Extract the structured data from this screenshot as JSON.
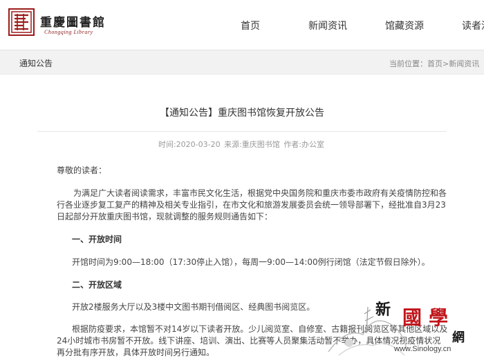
{
  "header": {
    "logo_cn": "重慶圖書館",
    "logo_en": "Chongqing Library",
    "nav": [
      "首页",
      "新闻资讯",
      "馆藏资源",
      "读者活"
    ]
  },
  "crumbbar": {
    "section_title": "通知公告",
    "location_label": "当前位置：",
    "crumbs": [
      "首页",
      ">",
      "新闻资讯"
    ]
  },
  "article": {
    "title": "【通知公告】重庆图书馆恢复开放公告",
    "time_label": "时间:2020-03-20",
    "source_label": "来源:重庆图书馆",
    "author_label": "作者:办公室",
    "greeting": "尊敬的读者：",
    "intro": "为满足广大读者阅读需求，丰富市民文化生活，根据党中央国务院和重庆市委市政府有关疫情防控和各行各业逐步复工复产的精神及相关专业指引，在市文化和旅游发展委员会统一领导部署下，经批准自3月23日起部分开放重庆图书馆，现就调整的服务规则通告如下：",
    "section1_heading": "一、开放时间",
    "section1_text": "开馆时间为9:00—18:00（17:30停止入馆），每周一9:00—14:00例行闭馆（法定节假日除外）。",
    "section2_heading": "二、开放区域",
    "section2_text": "开放2楼服务大厅以及3楼中文图书期刊借阅区、经典图书阅览区。",
    "section2_more": "根据防疫要求，本馆暂不对14岁以下读者开放。少儿阅览室、自修室、古籍报刊阅览区等其他区域以及24小时城市书房暂不开放。线下讲座、培训、演出、比赛等人员聚集活动暂不举办，具体情况视疫情状况再分批有序开放，具体开放时间另行通知。"
  },
  "watermark": {
    "xin": "新",
    "guo": "國",
    "xue": "學",
    "wang": "網",
    "url": "www.Sinology.cn"
  }
}
